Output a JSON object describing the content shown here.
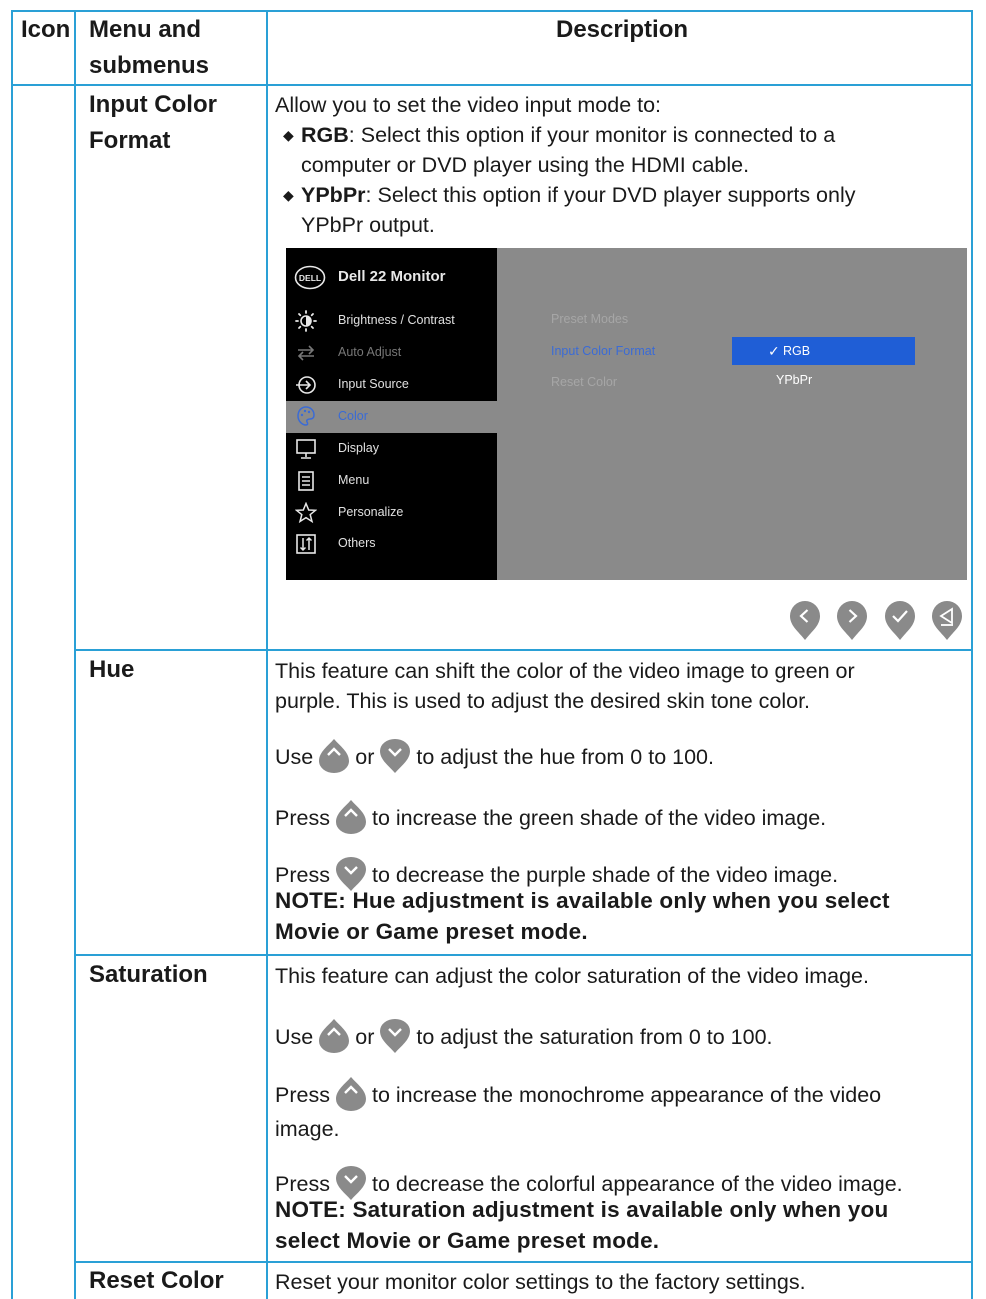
{
  "header": {
    "icon": "Icon",
    "menu_line1": "Menu and",
    "menu_line2": "submenus",
    "description": "Description"
  },
  "rows": {
    "input_color_format": {
      "menu_line1": "Input Color",
      "menu_line2": "Format",
      "intro": "Allow you to set the video input mode to:",
      "rgb_term": "RGB",
      "rgb_line1": ": Select this option if your monitor is connected to a",
      "rgb_line2": "computer or DVD player using the HDMI cable.",
      "ypbpr_term": "YPbPr",
      "ypbpr_line1": ": Select this option if your DVD player supports only",
      "ypbpr_line2": "YPbPr output."
    },
    "hue": {
      "menu": "Hue",
      "line1": "This feature can shift the color of the video image to green or",
      "line2": "purple. This is used to adjust the desired skin tone color.",
      "use_prefix": "Use",
      "use_or": "or",
      "use_suffix": "to adjust the hue from 0 to 100.",
      "press": "Press",
      "press_up": "to increase the green shade of the video image.",
      "press_down": "to decrease the purple shade of the video image.",
      "note_line1": "NOTE: Hue adjustment is available only when you select",
      "note_line2": "Movie or Game preset mode."
    },
    "saturation": {
      "menu": "Saturation",
      "line1": "This feature can adjust the color saturation of the video image.",
      "use_prefix": "Use",
      "use_or": "or",
      "use_suffix": "to adjust the saturation from 0 to 100.",
      "press": "Press",
      "press_up_line1": "to increase the monochrome appearance of the video",
      "press_up_line2": "image.",
      "press_down": "to decrease the colorful appearance of the video image.",
      "note_line1": "NOTE: Saturation adjustment is available only when you",
      "note_line2": "select Movie or Game preset mode."
    },
    "reset_color": {
      "menu": "Reset Color",
      "line1": "Reset your monitor color settings to the factory settings."
    }
  },
  "osd": {
    "logo": "DELL",
    "title": "Dell 22 Monitor",
    "menu": [
      {
        "label": "Brightness / Contrast",
        "icon": "brightness-icon"
      },
      {
        "label": "Auto Adjust",
        "icon": "auto-adjust-icon"
      },
      {
        "label": "Input Source",
        "icon": "input-source-icon"
      },
      {
        "label": "Color",
        "icon": "color-palette-icon"
      },
      {
        "label": "Display",
        "icon": "display-icon"
      },
      {
        "label": "Menu",
        "icon": "menu-icon"
      },
      {
        "label": "Personalize",
        "icon": "star-icon"
      },
      {
        "label": "Others",
        "icon": "others-icon"
      }
    ],
    "submenu": [
      "Preset Modes",
      "Input Color Format",
      "Reset Color"
    ],
    "options": [
      "RGB",
      "YPbPr"
    ],
    "check": "✓",
    "nav_icons": [
      "previous-icon",
      "next-icon",
      "confirm-icon",
      "back-icon"
    ]
  },
  "colors": {
    "border": "#2aa0d6",
    "osd_bg": "#8a8a8a",
    "osd_sidebar": "#000000",
    "highlight": "#1f5ed6",
    "button": "#8a8a8a"
  }
}
